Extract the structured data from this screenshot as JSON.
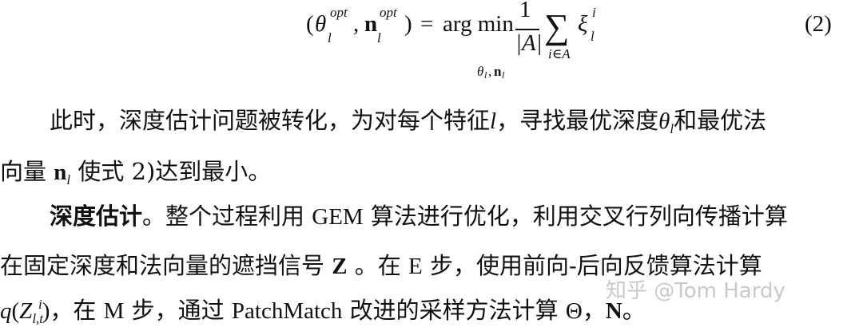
{
  "equation": {
    "paren_open": "(",
    "theta": "θ",
    "sub_l": "l",
    "sup_opt": "opt",
    "comma": ",",
    "n_bold": "n",
    "paren_close": ")",
    "equals": "=",
    "argmin": "arg min",
    "under_theta": "θ",
    "under_sub_l": "l",
    "under_comma": ",",
    "under_n": "n",
    "under_n_sub": "l",
    "numerator": "1",
    "denominator": "|A|",
    "sum": "∑",
    "sum_index": "i∈A",
    "xi": "ξ",
    "xi_sup": "i",
    "xi_sub": "l",
    "number": "(2)"
  },
  "paragraph1": {
    "l1_a": "此时，深度估计问题被转化，为对每个特征",
    "l1_l": "l",
    "l1_b": "，寻找最优深度",
    "l1_theta": "θ",
    "l1_theta_sub": "l",
    "l1_c": "和最优法",
    "l2_a": "向量",
    "l2_n": "n",
    "l2_n_sub": "l",
    "l2_b": "使式 2)达到最小。"
  },
  "paragraph2": {
    "l3_bold": "深度估计",
    "l3_a": "。整个过程利用",
    "l3_gem": "GEM",
    "l3_b": "算法进行优化，利用交叉行列向传播计算",
    "l4_a": "在固定深度和法向量的遮挡信号",
    "l4_z": "Z",
    "l4_b": "。在",
    "l4_e": "E",
    "l4_c": "步，使用前向-后向反馈算法计算",
    "l5_q": "q",
    "l5_paren_open": "(",
    "l5_Z": "Z",
    "l5_sub": "l,t",
    "l5_sup": "i",
    "l5_paren_close": ")",
    "l5_a": "，在",
    "l5_m": "M",
    "l5_b": "步，通过",
    "l5_pm": "PatchMatch",
    "l5_c": "改进的采样方法计算",
    "l5_theta": "Θ",
    "l5_d": "，",
    "l5_n": "N",
    "l5_e": "。"
  },
  "watermark": {
    "text": "知乎 @Tom Hardy"
  }
}
